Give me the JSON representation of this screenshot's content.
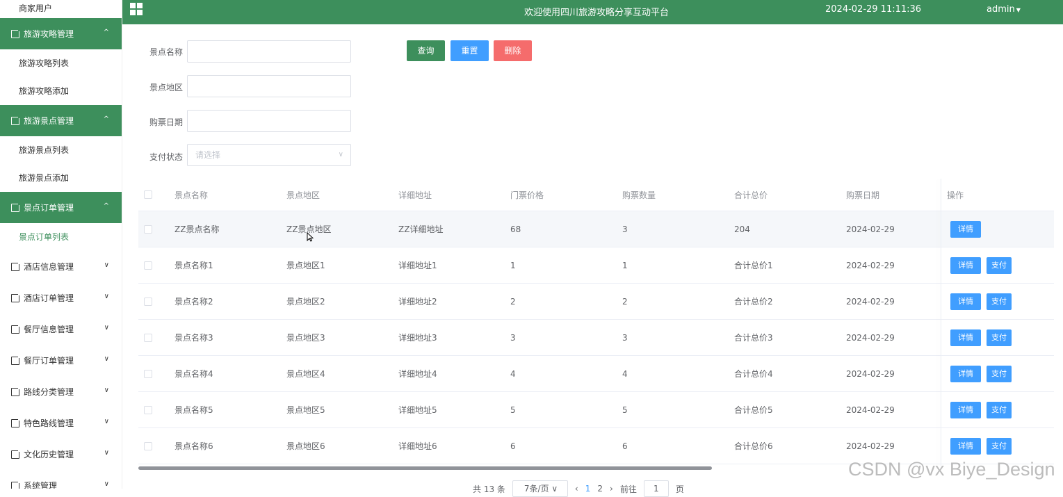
{
  "sidebar": {
    "top_item": "商家用户",
    "groups": [
      {
        "label": "旅游攻略管理",
        "open": true,
        "items": [
          "旅游攻略列表",
          "旅游攻略添加"
        ]
      },
      {
        "label": "旅游景点管理",
        "open": true,
        "items": [
          "旅游景点列表",
          "旅游景点添加"
        ]
      },
      {
        "label": "景点订单管理",
        "open": true,
        "items": [
          "景点订单列表"
        ]
      },
      {
        "label": "酒店信息管理",
        "open": false
      },
      {
        "label": "酒店订单管理",
        "open": false
      },
      {
        "label": "餐厅信息管理",
        "open": false
      },
      {
        "label": "餐厅订单管理",
        "open": false
      },
      {
        "label": "路线分类管理",
        "open": false
      },
      {
        "label": "特色路线管理",
        "open": false
      },
      {
        "label": "文化历史管理",
        "open": false
      },
      {
        "label": "系统管理",
        "open": false
      }
    ]
  },
  "topbar": {
    "title": "欢迎使用四川旅游攻略分享互动平台",
    "datetime": "2024-02-29 11:11:36",
    "user": "admin"
  },
  "search": {
    "name_label": "景点名称",
    "region_label": "景点地区",
    "date_label": "购票日期",
    "status_label": "支付状态",
    "status_placeholder": "请选择",
    "query_label": "查询",
    "reset_label": "重置",
    "delete_label": "删除"
  },
  "table": {
    "columns": [
      "景点名称",
      "景点地区",
      "详细地址",
      "门票价格",
      "购票数量",
      "合计总价",
      "购票日期"
    ],
    "op_header": "操作",
    "detail_label": "详情",
    "pay_label": "支付",
    "rows": [
      {
        "cells": [
          "ZZ景点名称",
          "ZZ景点地区",
          "ZZ详细地址",
          "68",
          "3",
          "204",
          "2024-02-29"
        ],
        "paid": true
      },
      {
        "cells": [
          "景点名称1",
          "景点地区1",
          "详细地址1",
          "1",
          "1",
          "合计总价1",
          "2024-02-29"
        ],
        "paid": false
      },
      {
        "cells": [
          "景点名称2",
          "景点地区2",
          "详细地址2",
          "2",
          "2",
          "合计总价2",
          "2024-02-29"
        ],
        "paid": false
      },
      {
        "cells": [
          "景点名称3",
          "景点地区3",
          "详细地址3",
          "3",
          "3",
          "合计总价3",
          "2024-02-29"
        ],
        "paid": false
      },
      {
        "cells": [
          "景点名称4",
          "景点地区4",
          "详细地址4",
          "4",
          "4",
          "合计总价4",
          "2024-02-29"
        ],
        "paid": false
      },
      {
        "cells": [
          "景点名称5",
          "景点地区5",
          "详细地址5",
          "5",
          "5",
          "合计总价5",
          "2024-02-29"
        ],
        "paid": false
      },
      {
        "cells": [
          "景点名称6",
          "景点地区6",
          "详细地址6",
          "6",
          "6",
          "合计总价6",
          "2024-02-29"
        ],
        "paid": false
      }
    ]
  },
  "pager": {
    "total": "共 13 条",
    "page_size": "7条/页",
    "pages": [
      "1",
      "2"
    ],
    "current": "1",
    "goto_label": "前往",
    "goto_value": "1",
    "page_suffix": "页"
  },
  "watermark": "CSDN @vx Biye_Design",
  "colors": {
    "primary": "#3d8f5c",
    "blue": "#409eff",
    "danger": "#f56c6c"
  }
}
